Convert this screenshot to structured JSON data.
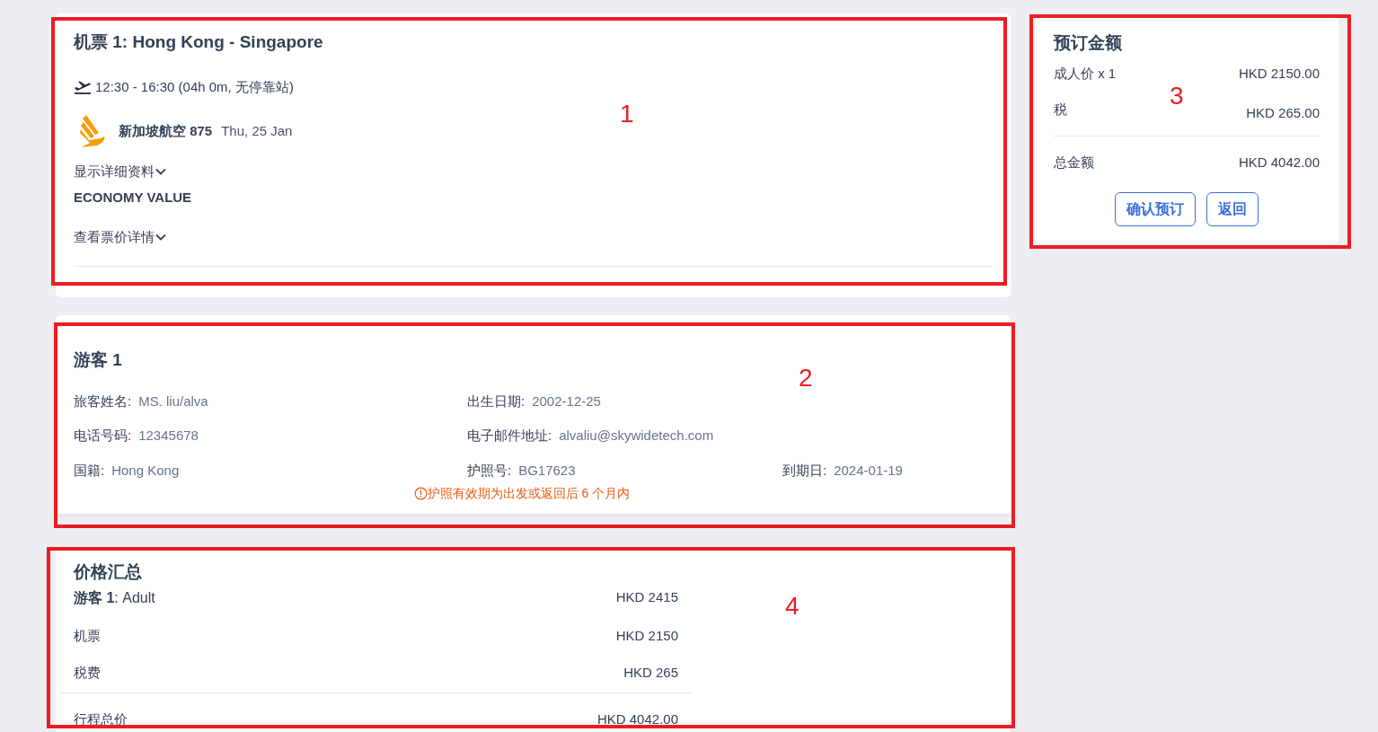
{
  "flight_card": {
    "title": "机票 1: Hong Kong - Singapore",
    "schedule": "12:30 - 16:30 (04h 0m, 无停靠站)",
    "airline_flight": "新加坡航空 875",
    "date": "Thu, 25 Jan",
    "show_details": {
      "label": "显示详细资料",
      "expanded": false
    },
    "fare_class": "ECONOMY VALUE",
    "fare_details": {
      "label": "查看票价详情",
      "expanded": false
    }
  },
  "passenger_card": {
    "title": "游客 1",
    "fields": [
      {
        "label": "旅客姓名:",
        "value": "MS. liu/alva"
      },
      {
        "label": "出生日期:",
        "value": "2002-12-25"
      },
      {
        "label": "电话号码:",
        "value": "12345678"
      },
      {
        "label": "电子邮件地址:",
        "value": "alvaliu@skywidetech.com"
      },
      {
        "label": "国籍:",
        "value": "Hong Kong"
      },
      {
        "label": "护照号:",
        "value": "BG17623"
      },
      {
        "label": "到期日:",
        "value": "2024-01-19"
      }
    ],
    "warning": "护照有效期为出发或返回后 6 个月内"
  },
  "price_summary": {
    "title": "价格汇总",
    "rows": [
      {
        "label": "**游客 1**: Adult",
        "amount": "HKD 2415"
      },
      {
        "label": "机票",
        "amount": "HKD 2150"
      },
      {
        "label": "税费",
        "amount": "HKD 265"
      }
    ],
    "total": {
      "label": "行程总价",
      "amount": "HKD 4042.00"
    }
  },
  "booking_amount": {
    "title": "预订金额",
    "rows": [
      {
        "label": "成人价 x 1",
        "amount": "HKD 2150.00"
      },
      {
        "label": "税",
        "amount": "HKD 265.00"
      }
    ],
    "total": {
      "label": "总金额",
      "amount": "HKD 4042.00"
    },
    "buttons": [
      "确认预订",
      "返回"
    ]
  },
  "annotations": [
    {
      "label": "1"
    },
    {
      "label": "2"
    },
    {
      "label": "3"
    },
    {
      "label": "4"
    }
  ]
}
